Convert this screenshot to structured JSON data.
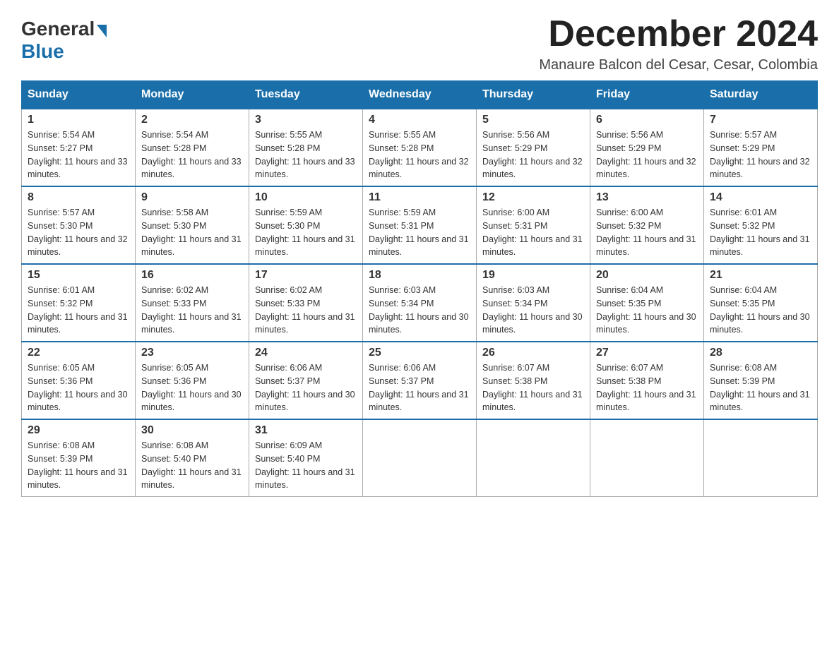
{
  "logo": {
    "general": "General",
    "blue": "Blue"
  },
  "header": {
    "month_title": "December 2024",
    "subtitle": "Manaure Balcon del Cesar, Cesar, Colombia"
  },
  "days_of_week": [
    "Sunday",
    "Monday",
    "Tuesday",
    "Wednesday",
    "Thursday",
    "Friday",
    "Saturday"
  ],
  "weeks": [
    [
      {
        "day": "1",
        "sunrise": "5:54 AM",
        "sunset": "5:27 PM",
        "daylight": "11 hours and 33 minutes."
      },
      {
        "day": "2",
        "sunrise": "5:54 AM",
        "sunset": "5:28 PM",
        "daylight": "11 hours and 33 minutes."
      },
      {
        "day": "3",
        "sunrise": "5:55 AM",
        "sunset": "5:28 PM",
        "daylight": "11 hours and 33 minutes."
      },
      {
        "day": "4",
        "sunrise": "5:55 AM",
        "sunset": "5:28 PM",
        "daylight": "11 hours and 32 minutes."
      },
      {
        "day": "5",
        "sunrise": "5:56 AM",
        "sunset": "5:29 PM",
        "daylight": "11 hours and 32 minutes."
      },
      {
        "day": "6",
        "sunrise": "5:56 AM",
        "sunset": "5:29 PM",
        "daylight": "11 hours and 32 minutes."
      },
      {
        "day": "7",
        "sunrise": "5:57 AM",
        "sunset": "5:29 PM",
        "daylight": "11 hours and 32 minutes."
      }
    ],
    [
      {
        "day": "8",
        "sunrise": "5:57 AM",
        "sunset": "5:30 PM",
        "daylight": "11 hours and 32 minutes."
      },
      {
        "day": "9",
        "sunrise": "5:58 AM",
        "sunset": "5:30 PM",
        "daylight": "11 hours and 31 minutes."
      },
      {
        "day": "10",
        "sunrise": "5:59 AM",
        "sunset": "5:30 PM",
        "daylight": "11 hours and 31 minutes."
      },
      {
        "day": "11",
        "sunrise": "5:59 AM",
        "sunset": "5:31 PM",
        "daylight": "11 hours and 31 minutes."
      },
      {
        "day": "12",
        "sunrise": "6:00 AM",
        "sunset": "5:31 PM",
        "daylight": "11 hours and 31 minutes."
      },
      {
        "day": "13",
        "sunrise": "6:00 AM",
        "sunset": "5:32 PM",
        "daylight": "11 hours and 31 minutes."
      },
      {
        "day": "14",
        "sunrise": "6:01 AM",
        "sunset": "5:32 PM",
        "daylight": "11 hours and 31 minutes."
      }
    ],
    [
      {
        "day": "15",
        "sunrise": "6:01 AM",
        "sunset": "5:32 PM",
        "daylight": "11 hours and 31 minutes."
      },
      {
        "day": "16",
        "sunrise": "6:02 AM",
        "sunset": "5:33 PM",
        "daylight": "11 hours and 31 minutes."
      },
      {
        "day": "17",
        "sunrise": "6:02 AM",
        "sunset": "5:33 PM",
        "daylight": "11 hours and 31 minutes."
      },
      {
        "day": "18",
        "sunrise": "6:03 AM",
        "sunset": "5:34 PM",
        "daylight": "11 hours and 30 minutes."
      },
      {
        "day": "19",
        "sunrise": "6:03 AM",
        "sunset": "5:34 PM",
        "daylight": "11 hours and 30 minutes."
      },
      {
        "day": "20",
        "sunrise": "6:04 AM",
        "sunset": "5:35 PM",
        "daylight": "11 hours and 30 minutes."
      },
      {
        "day": "21",
        "sunrise": "6:04 AM",
        "sunset": "5:35 PM",
        "daylight": "11 hours and 30 minutes."
      }
    ],
    [
      {
        "day": "22",
        "sunrise": "6:05 AM",
        "sunset": "5:36 PM",
        "daylight": "11 hours and 30 minutes."
      },
      {
        "day": "23",
        "sunrise": "6:05 AM",
        "sunset": "5:36 PM",
        "daylight": "11 hours and 30 minutes."
      },
      {
        "day": "24",
        "sunrise": "6:06 AM",
        "sunset": "5:37 PM",
        "daylight": "11 hours and 30 minutes."
      },
      {
        "day": "25",
        "sunrise": "6:06 AM",
        "sunset": "5:37 PM",
        "daylight": "11 hours and 31 minutes."
      },
      {
        "day": "26",
        "sunrise": "6:07 AM",
        "sunset": "5:38 PM",
        "daylight": "11 hours and 31 minutes."
      },
      {
        "day": "27",
        "sunrise": "6:07 AM",
        "sunset": "5:38 PM",
        "daylight": "11 hours and 31 minutes."
      },
      {
        "day": "28",
        "sunrise": "6:08 AM",
        "sunset": "5:39 PM",
        "daylight": "11 hours and 31 minutes."
      }
    ],
    [
      {
        "day": "29",
        "sunrise": "6:08 AM",
        "sunset": "5:39 PM",
        "daylight": "11 hours and 31 minutes."
      },
      {
        "day": "30",
        "sunrise": "6:08 AM",
        "sunset": "5:40 PM",
        "daylight": "11 hours and 31 minutes."
      },
      {
        "day": "31",
        "sunrise": "6:09 AM",
        "sunset": "5:40 PM",
        "daylight": "11 hours and 31 minutes."
      },
      null,
      null,
      null,
      null
    ]
  ],
  "labels": {
    "sunrise": "Sunrise:",
    "sunset": "Sunset:",
    "daylight": "Daylight:"
  }
}
